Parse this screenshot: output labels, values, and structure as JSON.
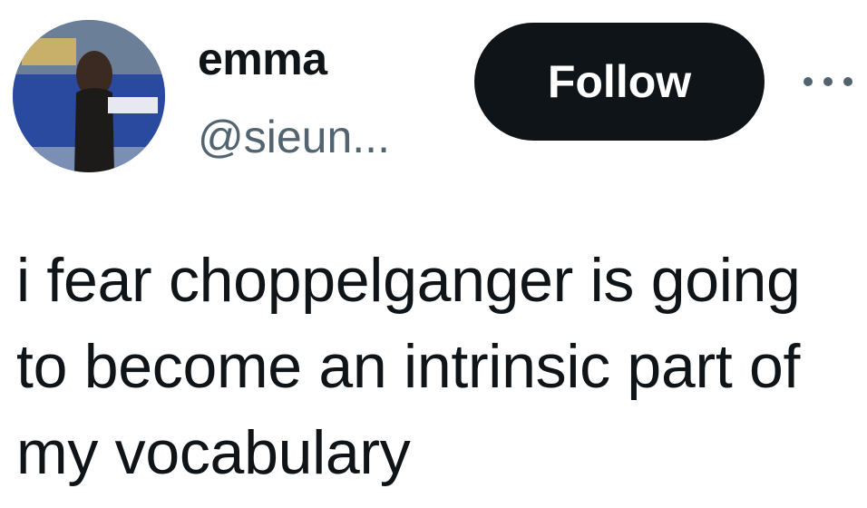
{
  "user": {
    "display_name": "emma",
    "handle": "@sieun...",
    "avatar_icon": "profile-photo"
  },
  "header": {
    "follow_label": "Follow",
    "more_icon": "more-horizontal-icon"
  },
  "tweet": {
    "text": "i fear choppelganger is going to become an intrinsic part of my vocabulary"
  },
  "colors": {
    "text_primary": "#0f1419",
    "text_secondary": "#536471",
    "button_bg": "#0f1419",
    "button_text": "#ffffff"
  }
}
